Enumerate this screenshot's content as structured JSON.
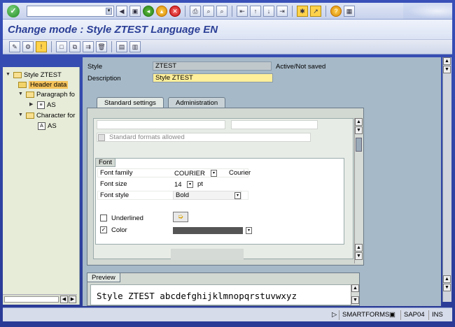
{
  "window": {
    "title": "Change mode : Style ZTEST Language EN"
  },
  "tree": {
    "items": [
      {
        "label": "Style ZTEST"
      },
      {
        "label": "Header data"
      },
      {
        "label": "Paragraph fo"
      },
      {
        "label": "AS"
      },
      {
        "label": "Character for"
      },
      {
        "label": "AS"
      }
    ]
  },
  "header": {
    "style_label": "Style",
    "style_value": "ZTEST",
    "status": "Active/Not saved",
    "description_label": "Description",
    "description_value": "Style ZTEST"
  },
  "tabs": [
    {
      "label": "Standard settings"
    },
    {
      "label": "Administration"
    }
  ],
  "standard": {
    "formats_allowed": "Standard formats allowed"
  },
  "font": {
    "group_title": "Font",
    "family_label": "Font family",
    "family_value": "COURIER",
    "family_desc": "Courier",
    "size_label": "Font size",
    "size_value": "14",
    "size_unit": "pt",
    "style_label": "Font style",
    "style_value": "Bold",
    "underlined_label": "Underlined",
    "color_label": "Color"
  },
  "preview": {
    "title": "Preview",
    "text": "Style ZTEST abcdefghijklmnopqrstuvwxyz"
  },
  "status": {
    "system": "SMARTFORMS",
    "server": "SAP04",
    "mode": "INS"
  }
}
